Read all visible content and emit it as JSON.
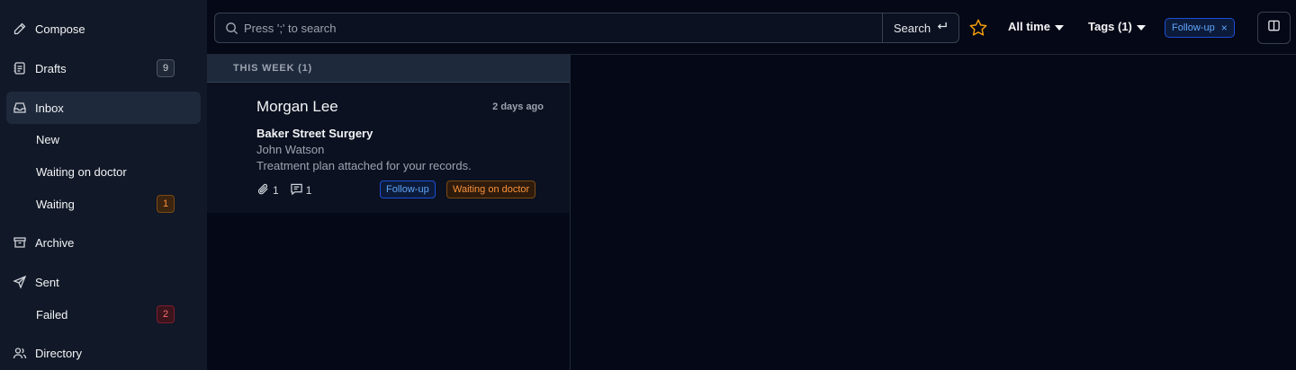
{
  "sidebar": {
    "items": [
      {
        "label": "Compose",
        "icon": "pencil-icon"
      },
      {
        "label": "Drafts",
        "icon": "drafts-icon",
        "badge": "9"
      },
      {
        "label": "Inbox",
        "icon": "inbox-icon",
        "active": true
      },
      {
        "label": "New"
      },
      {
        "label": "Waiting on doctor"
      },
      {
        "label": "Waiting",
        "badge": "1"
      },
      {
        "label": "Archive",
        "icon": "archive-icon"
      },
      {
        "label": "Sent",
        "icon": "send-icon"
      },
      {
        "label": "Failed",
        "badge": "2"
      },
      {
        "label": "Directory",
        "icon": "users-icon"
      }
    ]
  },
  "topbar": {
    "search_placeholder": "Press ';' to search",
    "search_button": "Search",
    "time_filter": "All time",
    "tags_filter": "Tags (1)",
    "active_tag": "Follow-up"
  },
  "list": {
    "group_header": "THIS WEEK (1)",
    "messages": [
      {
        "sender": "Morgan Lee",
        "time": "2 days ago",
        "subject": "Baker Street Surgery",
        "from": "John Watson",
        "preview": "Treatment plan attached for your records.",
        "attachments": "1",
        "comments": "1",
        "tags": [
          "Follow-up",
          "Waiting on doctor"
        ]
      }
    ]
  },
  "colors": {
    "accent_blue": "#60a5fa",
    "accent_orange": "#fb923c",
    "accent_red": "#f87171",
    "star": "#f59e0b"
  }
}
